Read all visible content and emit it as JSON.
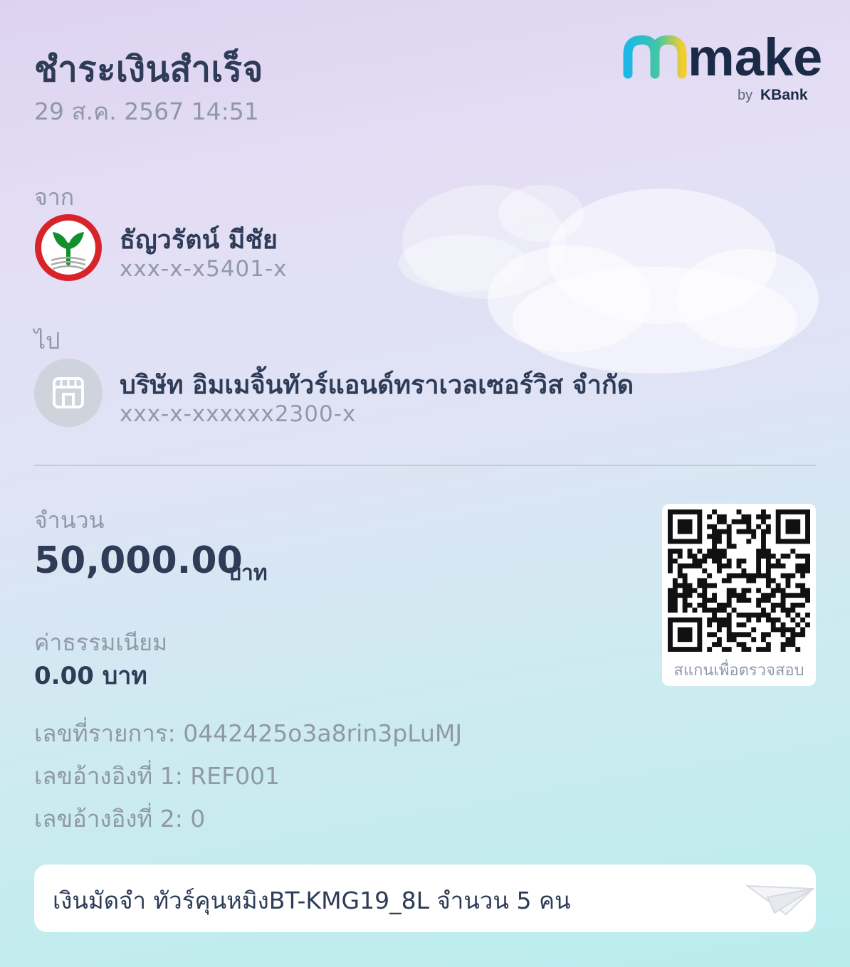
{
  "header": {
    "title": "ชำระเงินสำเร็จ",
    "datetime": "29 ส.ค. 2567 14:51",
    "logo_word": "make",
    "logo_by": "by",
    "logo_bank": "KBank"
  },
  "from": {
    "label": "จาก",
    "name": "ธัญวรัตน์ มีชัย",
    "account": "xxx-x-x5401-x",
    "icon": "kbank-logo-icon"
  },
  "to": {
    "label": "ไป",
    "name": "บริษัท อิมเมจิ้นทัวร์แอนด์ทราเวลเซอร์วิส จำกัด",
    "account": "xxx-x-xxxxxx2300-x",
    "icon": "store-icon"
  },
  "amount": {
    "label": "จำนวน",
    "value": "50,000.00",
    "unit": "บาท"
  },
  "fee": {
    "label": "ค่าธรรมเนียม",
    "value": "0.00 บาท"
  },
  "references": {
    "transaction": "เลขที่รายการ: 0442425o3a8rin3pLuMJ",
    "ref1": "เลขอ้างอิงที่ 1: REF001",
    "ref2": "เลขอ้างอิงที่ 2: 0"
  },
  "qr": {
    "caption": "สแกนเพื่อตรวจสอบ"
  },
  "memo": {
    "text": "เงินมัดจำ ทัวร์คุนหมิงBT-KMG19_8L จำนวน 5 คน",
    "icon": "paper-plane-icon"
  },
  "colors": {
    "text_primary": "#2e3c57",
    "text_secondary": "#9099aa",
    "kbank_green": "#138f2d",
    "kbank_red": "#d8232a",
    "logo_dark": "#1b2a47"
  }
}
